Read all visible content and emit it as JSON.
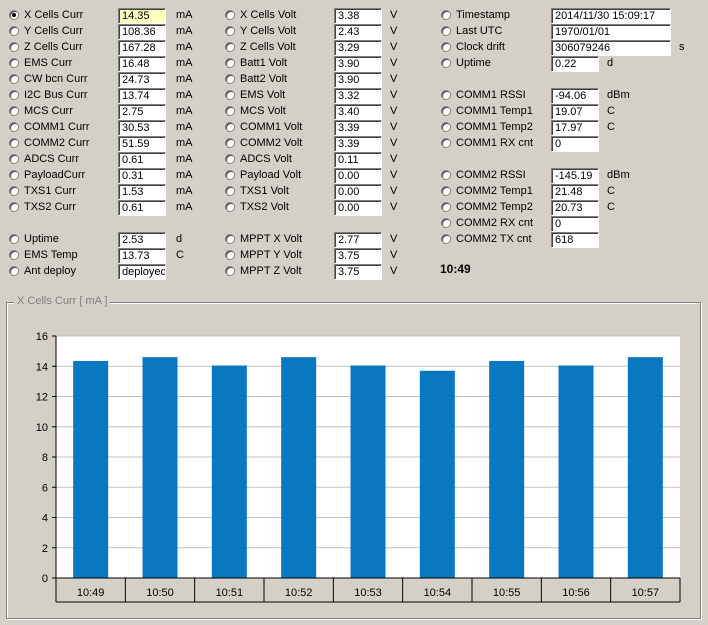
{
  "col1": [
    {
      "label": "X Cells Curr",
      "value": "14.35",
      "unit": "mA",
      "checked": true,
      "highlight": true
    },
    {
      "label": "Y Cells Curr",
      "value": "108.36",
      "unit": "mA"
    },
    {
      "label": "Z Cells Curr",
      "value": "167.28",
      "unit": "mA"
    },
    {
      "label": "EMS Curr",
      "value": "16.48",
      "unit": "mA"
    },
    {
      "label": "CW bcn Curr",
      "value": "24.73",
      "unit": "mA"
    },
    {
      "label": "I2C Bus Curr",
      "value": "13.74",
      "unit": "mA"
    },
    {
      "label": "MCS Curr",
      "value": "2.75",
      "unit": "mA"
    },
    {
      "label": "COMM1 Curr",
      "value": "30.53",
      "unit": "mA"
    },
    {
      "label": "COMM2 Curr",
      "value": "51.59",
      "unit": "mA"
    },
    {
      "label": "ADCS Curr",
      "value": "0.61",
      "unit": "mA"
    },
    {
      "label": "PayloadCurr",
      "value": "0.31",
      "unit": "mA"
    },
    {
      "label": "TXS1 Curr",
      "value": "1.53",
      "unit": "mA"
    },
    {
      "label": "TXS2 Curr",
      "value": "0.61",
      "unit": "mA"
    }
  ],
  "col1b": [
    {
      "label": "Uptime",
      "value": "2.53",
      "unit": "d"
    },
    {
      "label": "EMS Temp",
      "value": "13.73",
      "unit": "C"
    },
    {
      "label": "Ant deploy",
      "value": "deployed",
      "unit": ""
    }
  ],
  "col2": [
    {
      "label": "X Cells Volt",
      "value": "3.38",
      "unit": "V"
    },
    {
      "label": "Y Cells Volt",
      "value": "2.43",
      "unit": "V"
    },
    {
      "label": "Z Cells Volt",
      "value": "3.29",
      "unit": "V"
    },
    {
      "label": "Batt1 Volt",
      "value": "3.90",
      "unit": "V"
    },
    {
      "label": "Batt2 Volt",
      "value": "3.90",
      "unit": "V"
    },
    {
      "label": "EMS Volt",
      "value": "3.32",
      "unit": "V"
    },
    {
      "label": "MCS Volt",
      "value": "3.40",
      "unit": "V"
    },
    {
      "label": "COMM1 Volt",
      "value": "3.39",
      "unit": "V"
    },
    {
      "label": "COMM2 Volt",
      "value": "3.39",
      "unit": "V"
    },
    {
      "label": "ADCS Volt",
      "value": "0.11",
      "unit": "V"
    },
    {
      "label": "Payload Volt",
      "value": "0.00",
      "unit": "V"
    },
    {
      "label": "TXS1 Volt",
      "value": "0.00",
      "unit": "V"
    },
    {
      "label": "TXS2 Volt",
      "value": "0.00",
      "unit": "V"
    }
  ],
  "col2b": [
    {
      "label": "MPPT X Volt",
      "value": "2.77",
      "unit": "V"
    },
    {
      "label": "MPPT Y Volt",
      "value": "3.75",
      "unit": "V"
    },
    {
      "label": "MPPT Z Volt",
      "value": "3.75",
      "unit": "V"
    }
  ],
  "col3a": [
    {
      "label": "Timestamp",
      "value": "2014/11/30 15:09:17",
      "unit": ""
    },
    {
      "label": "Last UTC",
      "value": "1970/01/01",
      "unit": ""
    },
    {
      "label": "Clock drift",
      "value": "306079246",
      "unit": "s"
    },
    {
      "label": "Uptime",
      "value": "0.22",
      "unit": "d"
    }
  ],
  "col3b": [
    {
      "label": "COMM1 RSSI",
      "value": "-94.06",
      "unit": "dBm"
    },
    {
      "label": "COMM1 Temp1",
      "value": "19.07",
      "unit": "C"
    },
    {
      "label": "COMM1 Temp2",
      "value": "17.97",
      "unit": "C"
    },
    {
      "label": "COMM1 RX cnt",
      "value": "0",
      "unit": ""
    }
  ],
  "col3c": [
    {
      "label": "COMM2 RSSI",
      "value": "-145.19",
      "unit": "dBm"
    },
    {
      "label": "COMM2 Temp1",
      "value": "21.48",
      "unit": "C"
    },
    {
      "label": "COMM2 Temp2",
      "value": "20.73",
      "unit": "C"
    },
    {
      "label": "COMM2 RX cnt",
      "value": "0",
      "unit": ""
    },
    {
      "label": "COMM2 TX cnt",
      "value": "618",
      "unit": ""
    }
  ],
  "clock": "10:49",
  "group_title": "X Cells Curr  [ mA ]",
  "chart_data": {
    "type": "bar",
    "categories": [
      "10:49",
      "10:50",
      "10:51",
      "10:52",
      "10:53",
      "10:54",
      "10:55",
      "10:56",
      "10:57"
    ],
    "values": [
      14.35,
      14.6,
      14.05,
      14.6,
      14.05,
      13.7,
      14.35,
      14.05,
      14.6
    ],
    "ylim": [
      0,
      16
    ],
    "yticks": [
      0,
      2,
      4,
      6,
      8,
      10,
      12,
      14,
      16
    ],
    "grid": true,
    "colors": {
      "bar": "#0a78c0",
      "plot_bg": "#ffffff",
      "grid": "#c0c0c0"
    }
  }
}
